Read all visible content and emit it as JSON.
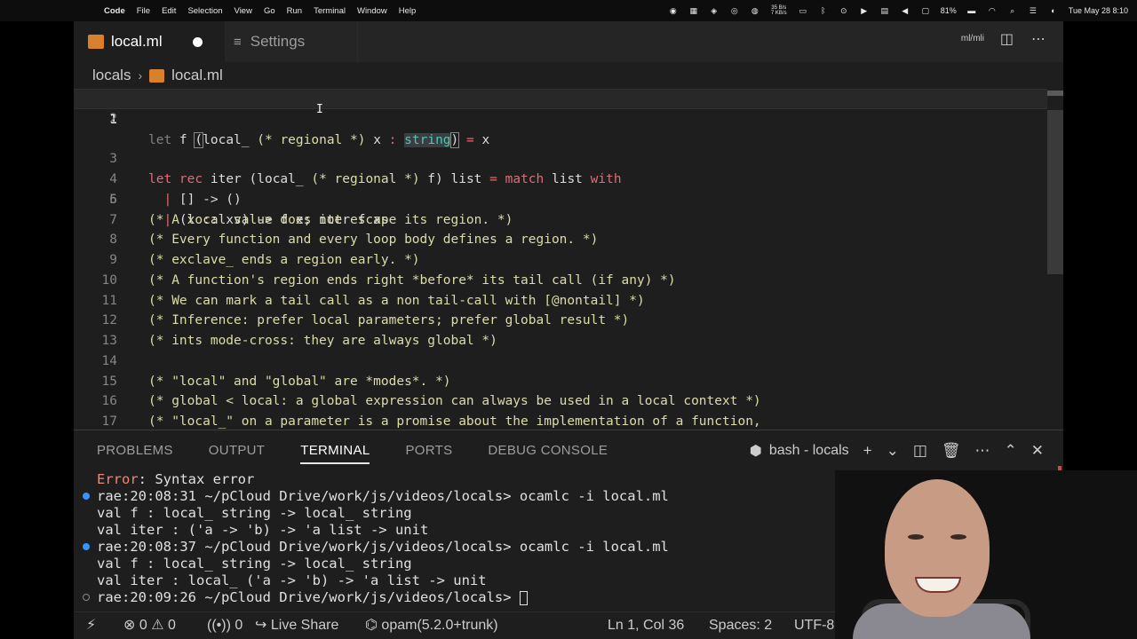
{
  "menubar": {
    "app": "Code",
    "items": [
      "File",
      "Edit",
      "Selection",
      "View",
      "Go",
      "Run",
      "Terminal",
      "Window",
      "Help"
    ],
    "netspeed_up": "35 B/s",
    "netspeed_down": "7 KB/s",
    "battery": "81%",
    "datetime": "Tue May 28  8:10"
  },
  "tabs": [
    {
      "label": "local.ml",
      "dirty": true,
      "active": true
    },
    {
      "label": "Settings",
      "active": false
    }
  ],
  "titlebar_actions": {
    "ml_mli": "ml/mli"
  },
  "breadcrumb": {
    "folder": "locals",
    "file": "local.ml"
  },
  "editor": {
    "lines": [
      {
        "n": "1"
      },
      {
        "n": "2"
      },
      {
        "n": "3"
      },
      {
        "n": "4"
      },
      {
        "n": "5"
      },
      {
        "n": "6"
      },
      {
        "n": "7",
        "text": "(* A local value does not escape its region. *)"
      },
      {
        "n": "8",
        "text": "(* Every function and every loop body defines a region. *)"
      },
      {
        "n": "9",
        "text": "(* exclave_ ends a region early. *)"
      },
      {
        "n": "10",
        "text": "(* A function's region ends right *before* its tail call (if any) *)"
      },
      {
        "n": "11",
        "text": "(* We can mark a tail call as a non tail-call with [@nontail] *)"
      },
      {
        "n": "12",
        "text": "(* Inference: prefer local parameters; prefer global result *)"
      },
      {
        "n": "13",
        "text": "(* ints mode-cross: they are always global *)"
      },
      {
        "n": "14"
      },
      {
        "n": "15",
        "text": "(* \"local\" and \"global\" are *modes*. *)"
      },
      {
        "n": "16",
        "text": "(* global < local: a global expression can always be used in a local context *)"
      },
      {
        "n": "17",
        "text": "(* \"local_\" on a parameter is a promise about the implementation of a function,"
      }
    ],
    "l1": {
      "let": "let",
      "f": " f ",
      "p1": "(",
      "local": "local_",
      "c": " (* regional *) ",
      "x": "x",
      "colon": " : ",
      "string": "string",
      "p2": ")",
      "eq": " = ",
      "rx": "x"
    },
    "l3": {
      "let": "let",
      "rec": " rec",
      "iter": " iter (local_ ",
      "c": "(* regional *)",
      "f": " f) list ",
      "eq": "=",
      "match": " match",
      "list": " list ",
      "with": "with"
    },
    "l4": {
      "bar": "  | ",
      "body": "[] -> ()"
    },
    "l5": {
      "bar": "  | ",
      "body": "(x :: xs) -> f x; iter f xs"
    }
  },
  "panel": {
    "tabs": [
      "PROBLEMS",
      "OUTPUT",
      "TERMINAL",
      "PORTS",
      "DEBUG CONSOLE"
    ],
    "active_tab": "TERMINAL",
    "terminal_name": "bash - locals"
  },
  "terminal": {
    "err_label": "Error",
    "err_rest": ": Syntax error",
    "lines": [
      "rae:20:08:31 ~/pCloud Drive/work/js/videos/locals> ocamlc -i local.ml",
      "val f : local_ string -> local_ string",
      "val iter : ('a -> 'b) -> 'a list -> unit",
      "rae:20:08:37 ~/pCloud Drive/work/js/videos/locals> ocamlc -i local.ml",
      "val f : local_ string -> local_ string",
      "val iter : local_ ('a -> 'b) -> 'a list -> unit",
      "rae:20:09:26 ~/pCloud Drive/work/js/videos/locals> "
    ]
  },
  "statusbar": {
    "errors": "0",
    "warnings": "0",
    "ports": "0",
    "live_share": "Live Share",
    "opam": "opam(5.2.0+trunk)",
    "position": "Ln 1, Col 36",
    "spaces": "Spaces: 2",
    "encoding": "UTF-8"
  }
}
